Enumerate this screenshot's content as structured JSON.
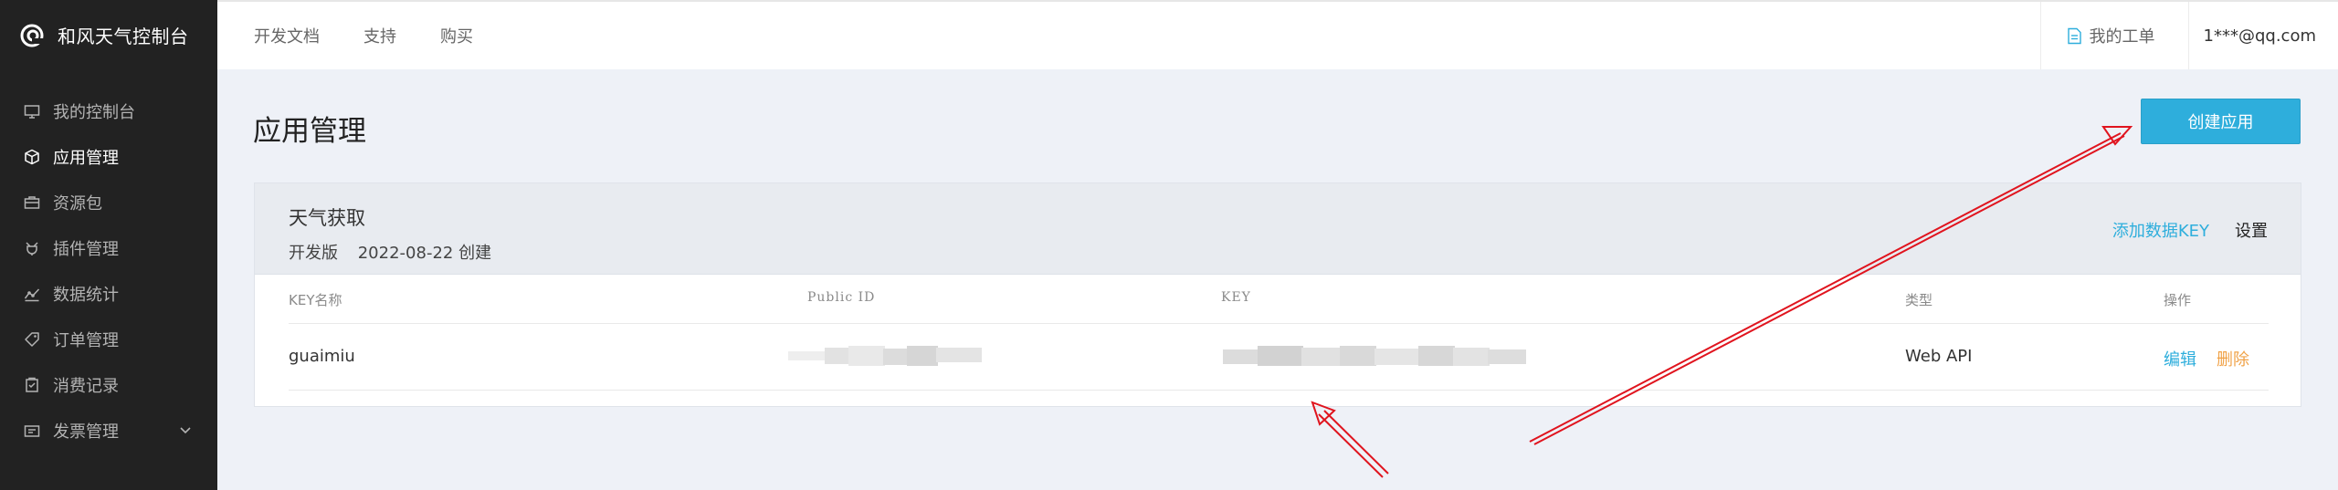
{
  "sidebar": {
    "brand": "和风天气控制台",
    "items": [
      {
        "label": "我的控制台",
        "icon": "monitor-icon"
      },
      {
        "label": "应用管理",
        "icon": "cube-icon",
        "active": true
      },
      {
        "label": "资源包",
        "icon": "briefcase-icon"
      },
      {
        "label": "插件管理",
        "icon": "plugin-icon"
      },
      {
        "label": "数据统计",
        "icon": "chart-icon"
      },
      {
        "label": "订单管理",
        "icon": "tag-icon"
      },
      {
        "label": "消费记录",
        "icon": "receipt-icon"
      },
      {
        "label": "发票管理",
        "icon": "invoice-icon",
        "expandable": true
      }
    ]
  },
  "topnav": {
    "links": [
      "开发文档",
      "支持",
      "购买"
    ],
    "ticket": "我的工单",
    "account": "1***@qq.com"
  },
  "main": {
    "title": "应用管理",
    "create_button": "创建应用"
  },
  "app": {
    "name": "天气获取",
    "edition": "开发版",
    "created": "2022-08-22 创建",
    "add_key": "添加数据KEY",
    "settings": "设置"
  },
  "table": {
    "headers": [
      "KEY名称",
      "Public ID",
      "KEY",
      "类型",
      "操作"
    ],
    "rows": [
      {
        "name": "guaimiu",
        "public_id": "",
        "key": "",
        "type": "Web API",
        "edit": "编辑",
        "delete": "删除"
      }
    ]
  },
  "colors": {
    "accent": "#2eaedc",
    "delete": "#f0a247",
    "sidebar": "#222222",
    "annotation": "#e0141e"
  }
}
